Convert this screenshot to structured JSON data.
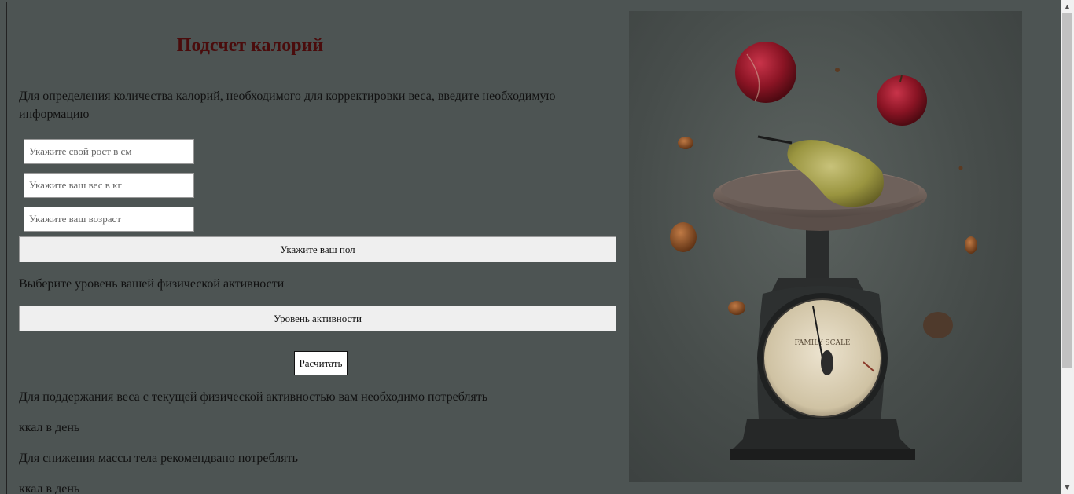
{
  "form": {
    "title": "Подсчет калорий",
    "intro": "Для определения количества калорий, необходимого для корректировки веса, введите необходимую информацию",
    "height_placeholder": "Укажите свой рост в см",
    "weight_placeholder": "Укажите ваш вес в кг",
    "age_placeholder": "Укажите ваш возраст",
    "gender_button": "Укажите ваш пол",
    "activity_prompt": "Выберите уровень вашей физической активности",
    "activity_button": "Уровень активности",
    "calculate_button": "Расчитать"
  },
  "results": {
    "maintain_text": "Для поддержания веса с текущей физической активностью вам необходимо потреблять",
    "maintain_unit": "ккал в день",
    "loss_text": "Для снижения массы тела рекомендвано потреблять",
    "loss_unit": "ккал в день"
  },
  "image": {
    "subject": "vintage kitchen scale with pear, plums and nuts",
    "scale_brand": "FAMILY SCALE"
  },
  "colors": {
    "background": "#4d5453",
    "title": "#4a0c0c"
  }
}
